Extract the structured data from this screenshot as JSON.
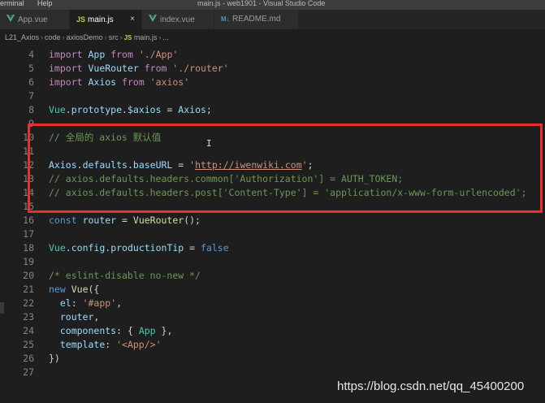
{
  "window": {
    "menu_terminal": "erminal",
    "menu_help": "Help",
    "title": "main.js - web1901 - Visual Studio Code"
  },
  "tabs": [
    {
      "label": "App.vue",
      "icon": "vue-icon"
    },
    {
      "label": "main.js",
      "icon": "js-icon",
      "icon_text": "JS",
      "active": true,
      "close": "×"
    },
    {
      "label": "index.vue",
      "icon": "vue-icon"
    },
    {
      "label": "README.md",
      "icon": "markdown-icon",
      "icon_text": "M↓"
    }
  ],
  "breadcrumb": {
    "items": [
      "L21_Axios",
      "code",
      "axiosDemo",
      "src",
      "main.js",
      "..."
    ],
    "separator": "›",
    "file_icon_text": "JS"
  },
  "code_lines": [
    {
      "n": "4",
      "tokens": [
        [
          "kw",
          "import"
        ],
        [
          "pu",
          " "
        ],
        [
          "vr",
          "App"
        ],
        [
          "pu",
          " "
        ],
        [
          "kw",
          "from"
        ],
        [
          "pu",
          " "
        ],
        [
          "str",
          "'./App'"
        ]
      ]
    },
    {
      "n": "5",
      "tokens": [
        [
          "kw",
          "import"
        ],
        [
          "pu",
          " "
        ],
        [
          "vr",
          "VueRouter"
        ],
        [
          "pu",
          " "
        ],
        [
          "kw",
          "from"
        ],
        [
          "pu",
          " "
        ],
        [
          "str",
          "'./router'"
        ]
      ]
    },
    {
      "n": "6",
      "tokens": [
        [
          "kw",
          "import"
        ],
        [
          "pu",
          " "
        ],
        [
          "vr",
          "Axios"
        ],
        [
          "pu",
          " "
        ],
        [
          "kw",
          "from"
        ],
        [
          "pu",
          " "
        ],
        [
          "str",
          "'axios'"
        ]
      ]
    },
    {
      "n": "7",
      "tokens": []
    },
    {
      "n": "8",
      "tokens": [
        [
          "cls",
          "Vue"
        ],
        [
          "pu",
          "."
        ],
        [
          "vr",
          "prototype"
        ],
        [
          "pu",
          "."
        ],
        [
          "vr",
          "$axios"
        ],
        [
          "pu",
          " = "
        ],
        [
          "vr",
          "Axios"
        ],
        [
          "pu",
          ";"
        ]
      ]
    },
    {
      "n": "9",
      "tokens": []
    },
    {
      "n": "10",
      "tokens": [
        [
          "cm",
          "// 全局的 axios 默认值"
        ]
      ]
    },
    {
      "n": "11",
      "tokens": []
    },
    {
      "n": "12",
      "tokens": [
        [
          "vr",
          "Axios"
        ],
        [
          "pu",
          "."
        ],
        [
          "vr",
          "defaults"
        ],
        [
          "pu",
          "."
        ],
        [
          "vr",
          "baseURL"
        ],
        [
          "pu",
          " = "
        ],
        [
          "str",
          "'"
        ],
        [
          "url",
          "http://iwenwiki.com"
        ],
        [
          "str",
          "'"
        ],
        [
          "pu",
          ";"
        ]
      ]
    },
    {
      "n": "13",
      "tokens": [
        [
          "cm",
          "// axios.defaults.headers.common['Authorization'] = AUTH_TOKEN;"
        ]
      ]
    },
    {
      "n": "14",
      "tokens": [
        [
          "cm",
          "// axios.defaults.headers.post['Content-Type'] = 'application/x-www-form-urlencoded';"
        ]
      ]
    },
    {
      "n": "15",
      "tokens": []
    },
    {
      "n": "16",
      "tokens": [
        [
          "cn",
          "const"
        ],
        [
          "pu",
          " "
        ],
        [
          "vr",
          "router"
        ],
        [
          "pu",
          " = "
        ],
        [
          "fn",
          "VueRouter"
        ],
        [
          "pu",
          "();"
        ]
      ]
    },
    {
      "n": "17",
      "tokens": []
    },
    {
      "n": "18",
      "tokens": [
        [
          "cls",
          "Vue"
        ],
        [
          "pu",
          "."
        ],
        [
          "vr",
          "config"
        ],
        [
          "pu",
          "."
        ],
        [
          "vr",
          "productionTip"
        ],
        [
          "pu",
          " = "
        ],
        [
          "cn",
          "false"
        ]
      ]
    },
    {
      "n": "19",
      "tokens": []
    },
    {
      "n": "20",
      "tokens": [
        [
          "cm",
          "/* eslint-disable no-new */"
        ]
      ]
    },
    {
      "n": "21",
      "tokens": [
        [
          "cn",
          "new"
        ],
        [
          "pu",
          " "
        ],
        [
          "fn",
          "Vue"
        ],
        [
          "pu",
          "({"
        ]
      ]
    },
    {
      "n": "22",
      "tokens": [
        [
          "pu",
          "  "
        ],
        [
          "vr",
          "el"
        ],
        [
          "pu",
          ": "
        ],
        [
          "str",
          "'#app'"
        ],
        [
          "pu",
          ","
        ]
      ]
    },
    {
      "n": "23",
      "tokens": [
        [
          "pu",
          "  "
        ],
        [
          "vr",
          "router"
        ],
        [
          "pu",
          ","
        ]
      ]
    },
    {
      "n": "24",
      "tokens": [
        [
          "pu",
          "  "
        ],
        [
          "vr",
          "components"
        ],
        [
          "pu",
          ": { "
        ],
        [
          "cls",
          "App"
        ],
        [
          "pu",
          " },"
        ]
      ]
    },
    {
      "n": "25",
      "tokens": [
        [
          "pu",
          "  "
        ],
        [
          "vr",
          "template"
        ],
        [
          "pu",
          ": "
        ],
        [
          "str",
          "'<App/>'"
        ]
      ]
    },
    {
      "n": "26",
      "tokens": [
        [
          "pu",
          "})"
        ]
      ]
    },
    {
      "n": "27",
      "tokens": []
    }
  ],
  "cursor_glyph": "I",
  "watermark": "https://blog.csdn.net/qq_45400200",
  "colors": {
    "editor_bg": "#1e1e1e",
    "highlight_box": "#e8312f",
    "vue_icon": "#41b883",
    "js_icon": "#cbcb41",
    "md_icon": "#519aba"
  }
}
